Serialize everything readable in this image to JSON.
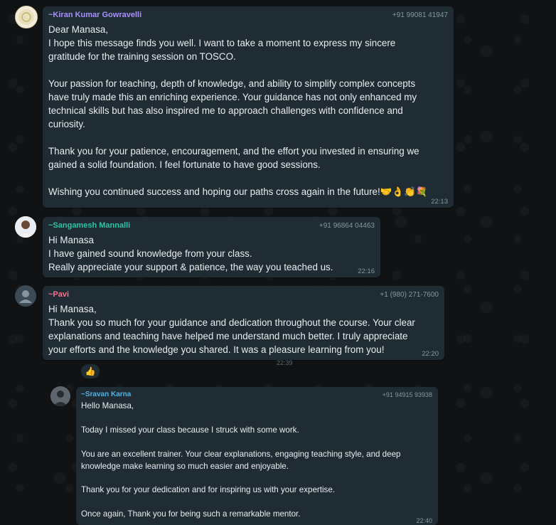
{
  "messages": [
    {
      "sender": "~Kiran Kumar Gowravelli",
      "phone": "+91 99081 41947",
      "sender_color": "#a890ff",
      "body": "Dear Manasa,\nI hope this message finds you well. I want to take a moment to express my sincere\ngratitude for the training session on TOSCO.\n\nYour passion for teaching, depth of knowledge, and ability to simplify complex concepts\nhave truly made this an enriching experience. Your guidance has not only enhanced my\ntechnical skills but has also inspired me to approach challenges with confidence and\ncuriosity.\n\nThank you for your patience, encouragement, and the effort you invested in ensuring we\ngained a solid foundation. I feel fortunate to have good sessions.\n\nWishing you continued success and hoping our paths cross again in the future!🤝👌👏💐",
      "time": "22:13"
    },
    {
      "sender": "~Sangamesh Mannalli",
      "phone": "+91 96864 04463",
      "sender_color": "#2fc4a8",
      "body": "Hi Manasa\nI have gained sound knowledge from your class.\nReally appreciate your support & patience, the way you teached us.",
      "time": "22:16"
    },
    {
      "sender": "~Pavi",
      "phone": "+1 (980) 271-7600",
      "sender_color": "#ff6f8e",
      "body": "Hi Manasa,\nThank you so much for your guidance and dedication throughout the course. Your clear\nexplanations and teaching have helped me understand much better. I truly appreciate\nyour efforts and the knowledge you shared. It was a pleasure learning from you!",
      "time": "22:20"
    },
    {
      "sender": "~Sravan Karna",
      "phone": "+91 94915 93938",
      "sender_color": "#4fb3e8",
      "body": "Hello Manasa,\n\nToday I missed your class because I struck with some work.\n\nYou are an excellent trainer. Your clear explanations, engaging teaching style, and deep\nknowledge make learning so much easier and enjoyable.\n\nThank you for your dedication and for inspiring us with your expertise.\n\nOnce again, Thank you for being such a remarkable mentor.",
      "time": "22:40"
    }
  ],
  "background_timestamp": "22:39",
  "reaction": "👍"
}
